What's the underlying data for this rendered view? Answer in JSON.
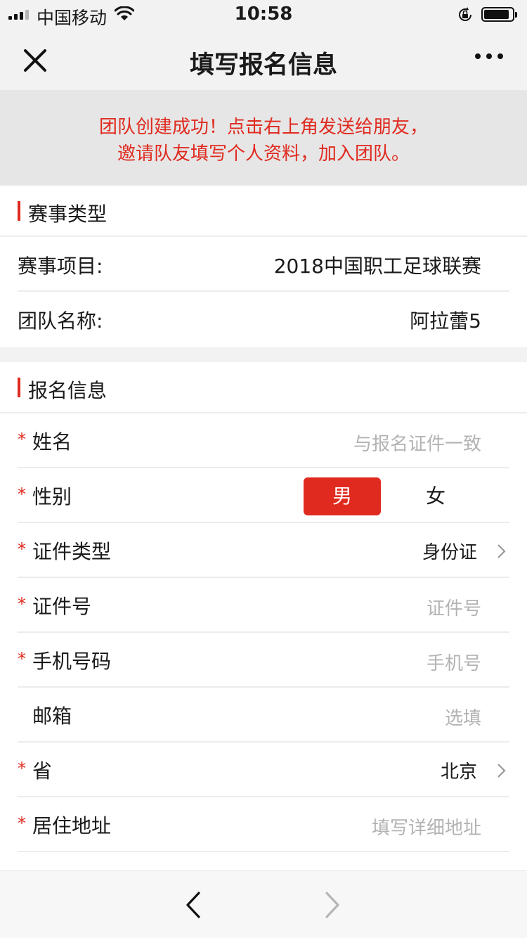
{
  "status_bar": {
    "carrier": "中国移动",
    "time": "10:58",
    "icons": [
      "signal-icon",
      "wifi-icon",
      "orientation-lock-icon",
      "battery-icon"
    ]
  },
  "nav": {
    "title": "填写报名信息",
    "left_icon": "close-icon",
    "right_icon": "more-icon"
  },
  "notice": {
    "line1": "团队创建成功！点击右上角发送给朋友，",
    "line2": "邀请队友填写个人资料，加入团队。",
    "color": "#e02a1f"
  },
  "event_section": {
    "title": "赛事类型",
    "rows": [
      {
        "label": "赛事项目:",
        "value": "2018中国职工足球联赛"
      },
      {
        "label": "团队名称:",
        "value": "阿拉蕾5"
      }
    ]
  },
  "signup_section": {
    "title": "报名信息",
    "required_mark": "*",
    "fields": {
      "name": {
        "label": "姓名",
        "placeholder": "与报名证件一致"
      },
      "gender": {
        "label": "性别",
        "options": [
          "男",
          "女"
        ],
        "selected": "男"
      },
      "id_type": {
        "label": "证件类型",
        "value": "身份证"
      },
      "id_number": {
        "label": "证件号",
        "placeholder": "证件号"
      },
      "phone": {
        "label": "手机号码",
        "placeholder": "手机号"
      },
      "email": {
        "label": "邮箱",
        "placeholder": "选填"
      },
      "province": {
        "label": "省",
        "value": "北京"
      },
      "address": {
        "label": "居住地址",
        "placeholder": "填写详细地址"
      }
    }
  },
  "toolbar": {
    "back_icon": "back-arrow-icon",
    "forward_icon": "forward-arrow-icon"
  },
  "colors": {
    "accent": "#e02a1f",
    "background": "#f2f2f2",
    "notice_bg": "#e6e6e6",
    "placeholder": "#b3b3b3"
  }
}
